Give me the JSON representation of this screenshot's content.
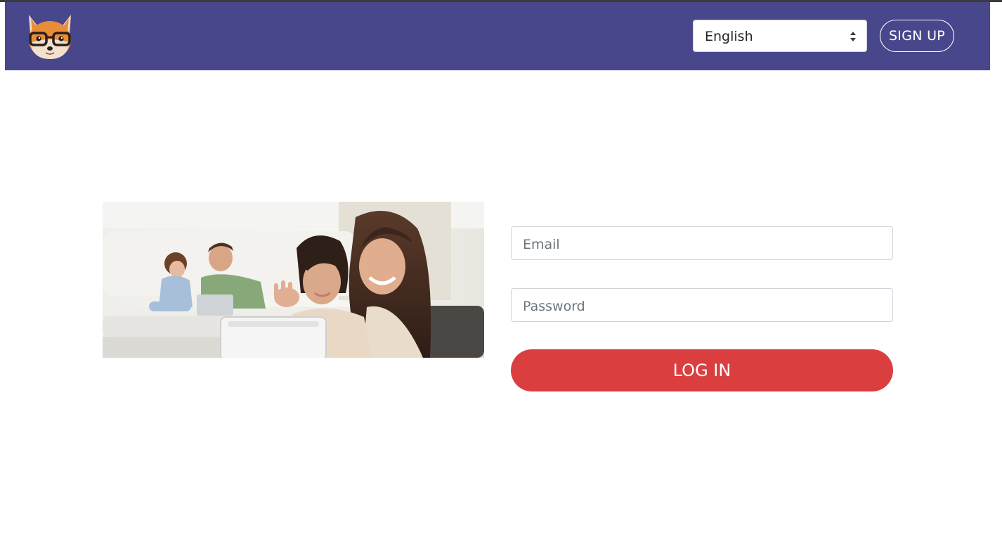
{
  "header": {
    "logo_icon": "fox-with-glasses-logo",
    "language_select": {
      "value": "English",
      "icon": "sort-arrows-icon"
    },
    "signup_label": "SIGN UP"
  },
  "login_form": {
    "email": {
      "placeholder": "Email",
      "value": ""
    },
    "password": {
      "placeholder": "Password",
      "value": ""
    },
    "login_label": "LOG IN"
  },
  "hero_image": {
    "subject": "family-with-tablet-photo"
  },
  "colors": {
    "navbar": "#49478c",
    "login_button": "#db3e3f",
    "page_background": "#ffffff"
  }
}
